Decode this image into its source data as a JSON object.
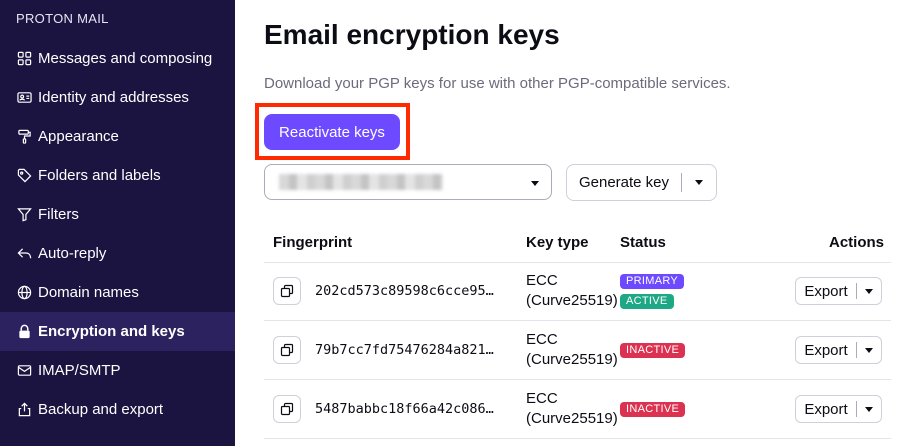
{
  "sidebar": {
    "heading": "PROTON MAIL",
    "items": [
      {
        "label": "Messages and composing",
        "icon": "grid-icon"
      },
      {
        "label": "Identity and addresses",
        "icon": "id-card-icon"
      },
      {
        "label": "Appearance",
        "icon": "paint-roller-icon"
      },
      {
        "label": "Folders and labels",
        "icon": "tag-icon"
      },
      {
        "label": "Filters",
        "icon": "filter-icon"
      },
      {
        "label": "Auto-reply",
        "icon": "reply-icon"
      },
      {
        "label": "Domain names",
        "icon": "globe-icon"
      },
      {
        "label": "Encryption and keys",
        "icon": "lock-icon",
        "active": true
      },
      {
        "label": "IMAP/SMTP",
        "icon": "envelope-icon"
      },
      {
        "label": "Backup and export",
        "icon": "export-icon"
      }
    ]
  },
  "main": {
    "title": "Email encryption keys",
    "description": "Download your PGP keys for use with other PGP-compatible services.",
    "reactivate_label": "Reactivate keys",
    "generate_label": "Generate key"
  },
  "table": {
    "headers": {
      "fingerprint": "Fingerprint",
      "key_type": "Key type",
      "status": "Status",
      "actions": "Actions"
    },
    "rows": [
      {
        "fingerprint": "202cd573c89598c6cce95…",
        "type_line1": "ECC",
        "type_line2": "(Curve25519)",
        "badges": [
          "PRIMARY",
          "ACTIVE"
        ],
        "export_label": "Export"
      },
      {
        "fingerprint": "79b7cc7fd75476284a821…",
        "type_line1": "ECC",
        "type_line2": "(Curve25519)",
        "badges": [
          "INACTIVE"
        ],
        "export_label": "Export"
      },
      {
        "fingerprint": "5487babbc18f66a42c086…",
        "type_line1": "ECC",
        "type_line2": "(Curve25519)",
        "badges": [
          "INACTIVE"
        ],
        "export_label": "Export"
      }
    ]
  },
  "colors": {
    "sidebar_bg": "#1b1340",
    "sidebar_active_bg": "#2d2260",
    "primary": "#6d4aff",
    "active_badge": "#1ea885",
    "inactive_badge": "#dc3251",
    "highlight": "#ff2a00"
  }
}
